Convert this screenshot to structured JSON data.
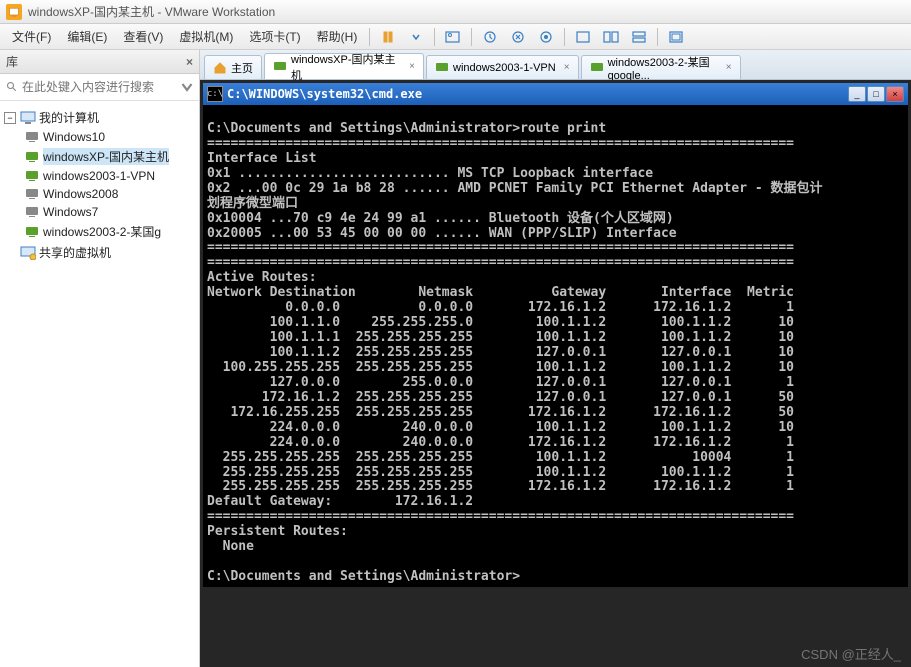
{
  "window": {
    "title": "windowsXP-国内某主机 - VMware Workstation"
  },
  "menu": {
    "file": "文件(F)",
    "edit": "编辑(E)",
    "view": "查看(V)",
    "vm": "虚拟机(M)",
    "tabs": "选项卡(T)",
    "help": "帮助(H)"
  },
  "sidebar": {
    "title": "库",
    "search_placeholder": "在此处键入内容进行搜索",
    "root": "我的计算机",
    "items": [
      "Windows10",
      "windowsXP-国内某主机",
      "windows2003-1-VPN",
      "Windows2008",
      "Windows7",
      "windows2003-2-某国g"
    ],
    "shared": "共享的虚拟机"
  },
  "tabs": [
    {
      "label": "主页",
      "icon": "home"
    },
    {
      "label": "windowsXP-国内某主机",
      "icon": "vm-active",
      "active": true
    },
    {
      "label": "windows2003-1-VPN",
      "icon": "vm"
    },
    {
      "label": "windows2003-2-某国google...",
      "icon": "vm"
    }
  ],
  "cmd": {
    "title": "C:\\WINDOWS\\system32\\cmd.exe",
    "prompt1": "C:\\Documents and Settings\\Administrator>route print",
    "divider": "===========================================================================",
    "interface_header": "Interface List",
    "iface_lines": [
      "0x1 ........................... MS TCP Loopback interface",
      "0x2 ...00 0c 29 1a b8 28 ...... AMD PCNET Family PCI Ethernet Adapter - 数据包计",
      "划程序微型端口",
      "0x10004 ...70 c9 4e 24 99 a1 ...... Bluetooth 设备(个人区域网)",
      "0x20005 ...00 53 45 00 00 00 ...... WAN (PPP/SLIP) Interface"
    ],
    "active_routes": "Active Routes:",
    "route_header": "Network Destination        Netmask          Gateway       Interface  Metric",
    "routes": [
      "          0.0.0.0          0.0.0.0       172.16.1.2      172.16.1.2       1",
      "        100.1.1.0    255.255.255.0        100.1.1.2       100.1.1.2      10",
      "        100.1.1.1  255.255.255.255        100.1.1.2       100.1.1.2      10",
      "        100.1.1.2  255.255.255.255        127.0.0.1       127.0.0.1      10",
      "  100.255.255.255  255.255.255.255        100.1.1.2       100.1.1.2      10",
      "        127.0.0.0        255.0.0.0        127.0.0.1       127.0.0.1       1",
      "       172.16.1.2  255.255.255.255        127.0.0.1       127.0.0.1      50",
      "   172.16.255.255  255.255.255.255       172.16.1.2      172.16.1.2      50",
      "        224.0.0.0        240.0.0.0        100.1.1.2       100.1.1.2      10",
      "        224.0.0.0        240.0.0.0       172.16.1.2      172.16.1.2       1",
      "  255.255.255.255  255.255.255.255        100.1.1.2           10004       1",
      "  255.255.255.255  255.255.255.255        100.1.1.2       100.1.1.2       1",
      "  255.255.255.255  255.255.255.255       172.16.1.2      172.16.1.2       1"
    ],
    "default_gw": "Default Gateway:        172.16.1.2",
    "persistent": "Persistent Routes:",
    "none": "  None",
    "prompt2": "C:\\Documents and Settings\\Administrator>"
  },
  "watermark": "CSDN @正经人_"
}
